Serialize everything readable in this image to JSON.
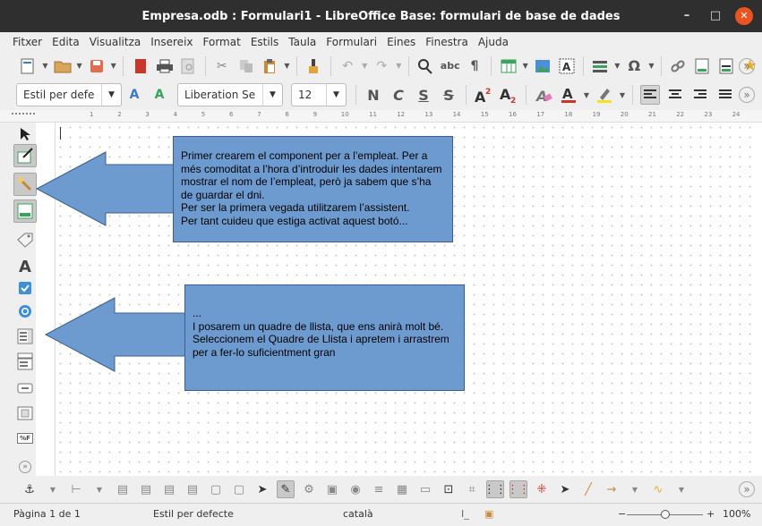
{
  "window": {
    "title": "Empresa.odb : Formulari1 - LibreOffice Base: formulari de base de dades",
    "minimize_glyph": "–",
    "maximize_glyph": "□",
    "close_glyph": "✕"
  },
  "menu": [
    "Fitxer",
    "Edita",
    "Visualitza",
    "Insereix",
    "Format",
    "Estils",
    "Taula",
    "Formulari",
    "Eines",
    "Finestra",
    "Ajuda"
  ],
  "format_toolbar": {
    "paragraph_style": "Estil per defe",
    "font_name": "Liberation Se",
    "font_size": "12",
    "bold_glyph": "N",
    "italic_glyph": "C",
    "underline_glyph": "S",
    "strike_glyph": "S"
  },
  "ruler": {
    "ticks": [
      "1",
      "2",
      "3",
      "4",
      "5",
      "6",
      "7",
      "8",
      "9",
      "10",
      "11",
      "12",
      "13",
      "14",
      "15",
      "16",
      "17",
      "18",
      "19",
      "20",
      "21",
      "22",
      "23",
      "24"
    ]
  },
  "icons": {
    "left_toolbar": [
      "select-arrow-icon",
      "design-mode-icon",
      "control-wizards-icon",
      "form-design-icon",
      "label-tag-icon",
      "text-box-icon",
      "checkbox-icon",
      "option-button-icon",
      "list-box-icon",
      "combo-box-icon",
      "push-button-icon",
      "image-control-icon",
      "formatted-field-icon",
      "more-controls-icon"
    ],
    "colors": {
      "title_bg": "#2f2f2f",
      "close_btn": "#e95420",
      "callout_fill": "#6d9bd0",
      "callout_border": "#3a5f8f",
      "toolbar_bg": "#efefef"
    }
  },
  "callouts": [
    {
      "text": "Primer crearem el component per a l’empleat. Per a més comoditat a l’hora d’introduir les dades intentarem mostrar el nom de l’empleat, però ja sabem que s’ha de guardar el dni.\nPer ser la primera vegada utilitzarem l’assistent.\nPer tant cuideu que estiga activat aquest botó..."
    },
    {
      "text": "...\nI posarem un quadre de llista, que ens anirà molt bé.\nSeleccionem el Quadre de Llista i apretem i arrastrem per a fer-lo suficientment gran"
    }
  ],
  "statusbar": {
    "page": "Pàgina 1 de 1",
    "style": "Estil per defecte",
    "language": "català",
    "zoom_minus": "−",
    "zoom_plus": "+",
    "zoom": "100%",
    "zoom_level_fraction": 0.5
  }
}
